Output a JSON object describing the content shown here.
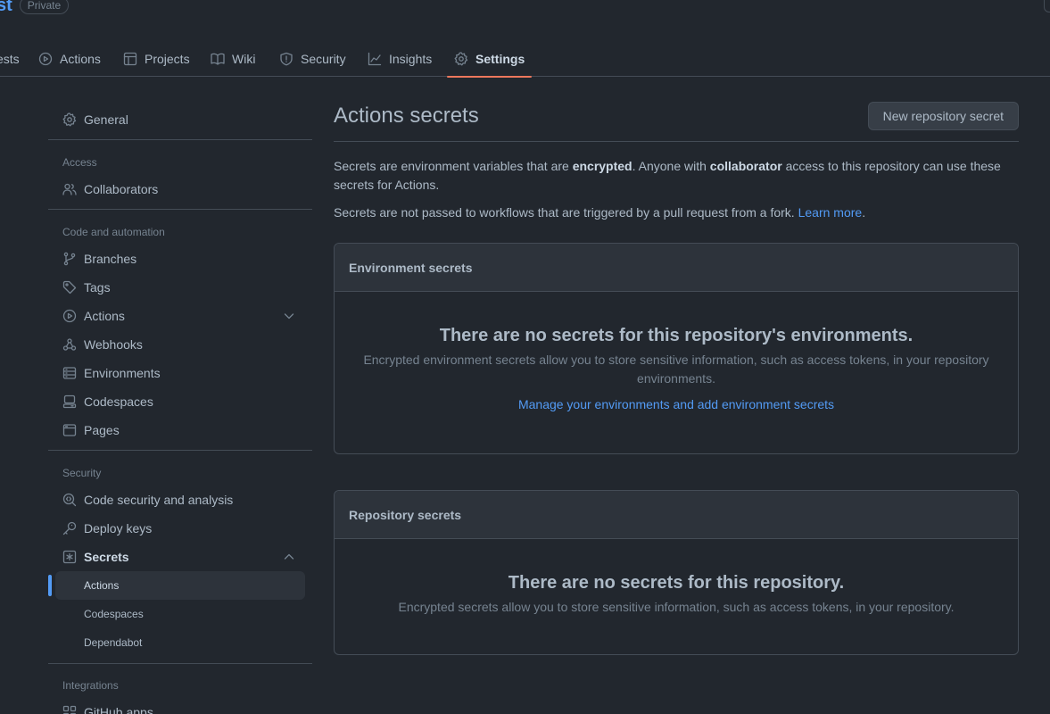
{
  "repo": {
    "name_fragment": "st",
    "visibility": "Private"
  },
  "tabs": [
    {
      "label": "ests",
      "icon": "pull-request-icon"
    },
    {
      "label": "Actions",
      "icon": "play-icon"
    },
    {
      "label": "Projects",
      "icon": "table-icon"
    },
    {
      "label": "Wiki",
      "icon": "book-icon"
    },
    {
      "label": "Security",
      "icon": "shield-icon"
    },
    {
      "label": "Insights",
      "icon": "graph-icon"
    },
    {
      "label": "Settings",
      "icon": "gear-icon"
    }
  ],
  "sidebar": {
    "general": "General",
    "access_heading": "Access",
    "collaborators": "Collaborators",
    "code_heading": "Code and automation",
    "branches": "Branches",
    "tags": "Tags",
    "actions": "Actions",
    "webhooks": "Webhooks",
    "environments": "Environments",
    "codespaces": "Codespaces",
    "pages": "Pages",
    "security_heading": "Security",
    "code_security": "Code security and analysis",
    "deploy_keys": "Deploy keys",
    "secrets": "Secrets",
    "secrets_actions": "Actions",
    "secrets_codespaces": "Codespaces",
    "secrets_dependabot": "Dependabot",
    "integrations_heading": "Integrations",
    "github_apps": "GitHub apps"
  },
  "main": {
    "title": "Actions secrets",
    "new_button": "New repository secret",
    "intro_1": "Secrets are environment variables that are ",
    "intro_bold_1": "encrypted",
    "intro_2": ". Anyone with ",
    "intro_bold_2": "collaborator",
    "intro_3": " access to this repository can use these secrets for Actions.",
    "fork_note": "Secrets are not passed to workflows that are triggered by a pull request from a fork. ",
    "learn_more": "Learn more",
    "period": ".",
    "env_box": {
      "heading": "Environment secrets",
      "empty_title": "There are no secrets for this repository's environments.",
      "empty_desc": "Encrypted environment secrets allow you to store sensitive information, such as access tokens, in your repository environments.",
      "link": "Manage your environments and add environment secrets"
    },
    "repo_box": {
      "heading": "Repository secrets",
      "empty_title": "There are no secrets for this repository.",
      "empty_desc": "Encrypted secrets allow you to store sensitive information, such as access tokens, in your repository."
    }
  },
  "colors": {
    "accent": "#539bf5",
    "tab_underline": "#ec775c",
    "background": "#22272e"
  }
}
